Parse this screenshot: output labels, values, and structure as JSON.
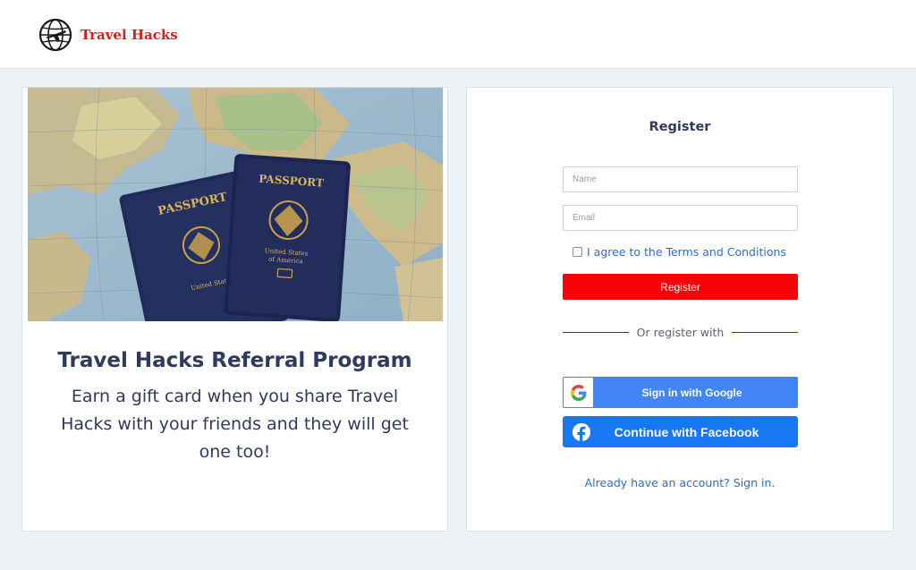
{
  "header": {
    "brand_name": "Travel Hacks",
    "logo_icon": "globe-airplane-icon",
    "brand_color": "#e01b1b"
  },
  "promo": {
    "image_icon": "passports-on-map-image",
    "passport_label": "PASSPORT",
    "passport_country_line1": "United States",
    "passport_country_line2": "of America",
    "title": "Travel Hacks Referral Program",
    "body": "Earn a gift card when you share Travel Hacks with your friends and they will get one too!"
  },
  "register": {
    "title": "Register",
    "name_placeholder": "Name",
    "email_placeholder": "Email",
    "agree_label": "I agree to the Terms and Conditions",
    "register_button": "Register",
    "divider_text": "Or register with",
    "google_button": "Sign in with Google",
    "facebook_button": "Continue with Facebook",
    "signin_link": "Already have an account? Sign in."
  },
  "colors": {
    "accent_red": "#fb0006",
    "google_blue": "#4285f4",
    "facebook_blue": "#1877f2",
    "link_blue": "#2a6fcf",
    "heading_navy": "#2f3a5e"
  }
}
